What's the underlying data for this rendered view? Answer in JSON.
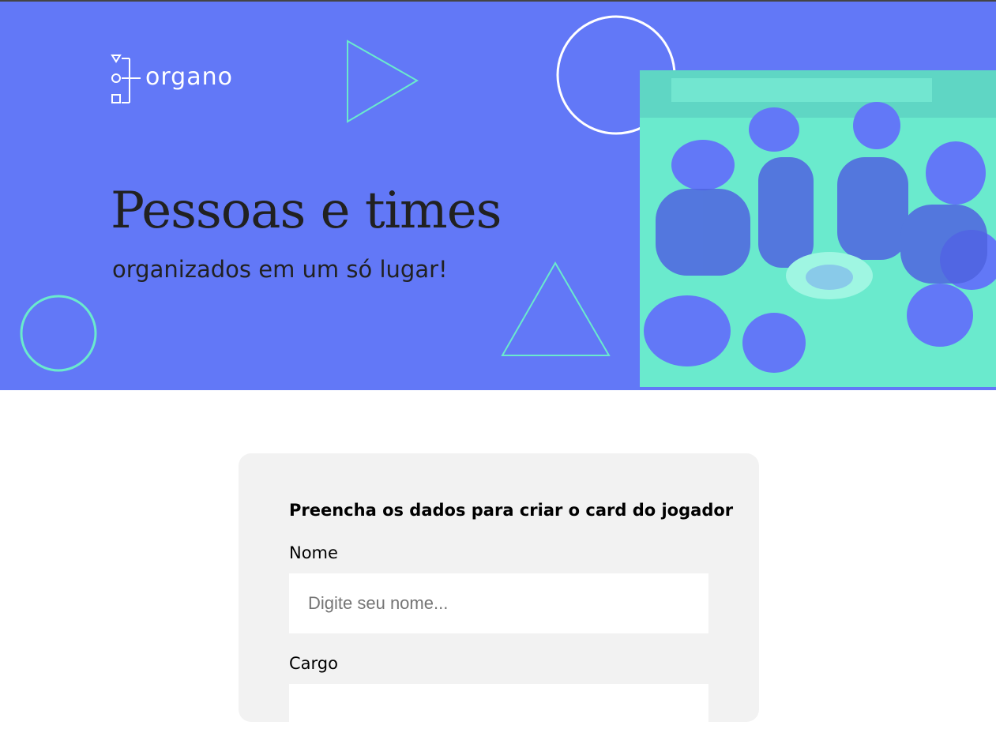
{
  "brand": {
    "name": "organo",
    "primary_color": "#6278f7",
    "accent_color": "#6aeacd"
  },
  "banner": {
    "headline": "Pessoas e times",
    "subheadline": "organizados em um só lugar!",
    "image_icon": "team-photo"
  },
  "form": {
    "title": "Preencha os dados para criar o card do jogador",
    "fields": [
      {
        "label": "Nome",
        "placeholder": "Digite seu nome...",
        "value": ""
      },
      {
        "label": "Cargo",
        "placeholder": "",
        "value": ""
      }
    ]
  }
}
